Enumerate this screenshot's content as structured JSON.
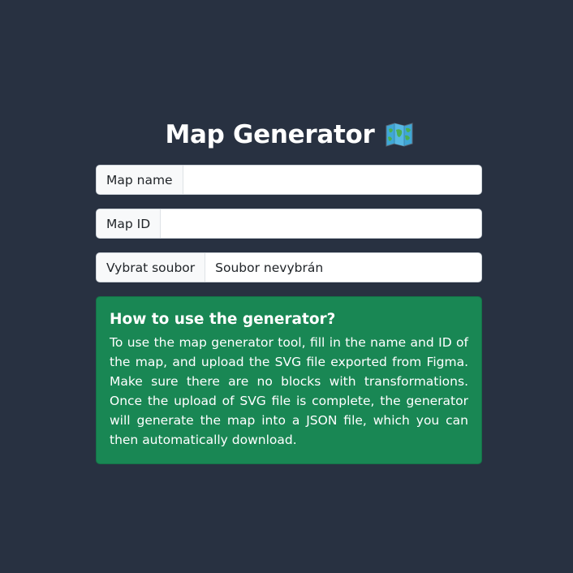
{
  "page": {
    "title": "Map Generator",
    "title_icon": "world-map-emoji"
  },
  "form": {
    "map_name_label": "Map name",
    "map_name_value": "",
    "map_id_label": "Map ID",
    "map_id_value": "",
    "file_button_label": "Vybrat soubor",
    "file_status": "Soubor nevybrán"
  },
  "info": {
    "heading": "How to use the generator?",
    "body": "To use the map generator tool, fill in the name and ID of the map, and upload the SVG file exported from Figma. Make sure there are no blocks with transformations. Once the upload of SVG file is complete, the generator will generate the map into a JSON file, which you can then automatically download."
  },
  "colors": {
    "background": "#283141",
    "alert_success": "#198754",
    "input_addon": "#f8f9fa"
  }
}
